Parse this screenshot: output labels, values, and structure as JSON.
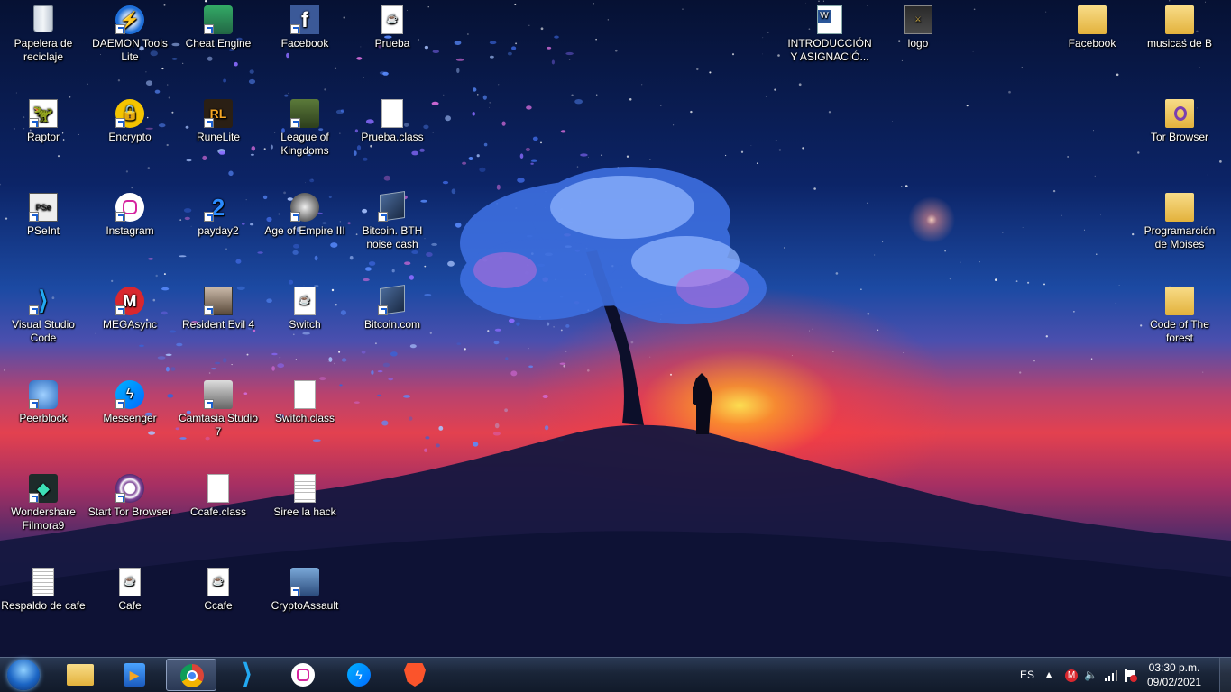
{
  "desktop": {
    "icons": [
      {
        "name": "recycle-bin",
        "label": "Papelera de reciclaje",
        "icon": "recycle-bin-icon",
        "shortcut": false
      },
      {
        "name": "daemon-tools-lite",
        "label": "DAEMON Tools Lite",
        "icon": "daemon-tools-icon",
        "shortcut": true
      },
      {
        "name": "cheat-engine",
        "label": "Cheat Engine",
        "icon": "cheat-engine-icon",
        "shortcut": true
      },
      {
        "name": "facebook",
        "label": "Facebook",
        "icon": "facebook-icon",
        "shortcut": true
      },
      {
        "name": "prueba",
        "label": "Prueba",
        "icon": "java-file-icon",
        "shortcut": false
      },
      {
        "name": "introduccion-doc",
        "label": "INTRODUCCIÓN Y ASIGNACIÓ...",
        "icon": "word-document-icon",
        "shortcut": false
      },
      {
        "name": "logo",
        "label": "logo",
        "icon": "image-file-icon",
        "shortcut": false
      },
      {
        "name": "facebook-folder",
        "label": "Facebook",
        "icon": "folder-icon",
        "shortcut": false
      },
      {
        "name": "musicas-de-b",
        "label": "musicas de B",
        "icon": "folder-icon",
        "shortcut": false
      },
      {
        "name": "raptor",
        "label": "Raptor",
        "icon": "raptor-icon",
        "shortcut": true
      },
      {
        "name": "encrypto",
        "label": "Encrypto",
        "icon": "encrypto-icon",
        "shortcut": true
      },
      {
        "name": "runelite",
        "label": "RuneLite",
        "icon": "runelite-icon",
        "shortcut": true
      },
      {
        "name": "league-of-kingdoms",
        "label": "League of Kingdoms",
        "icon": "league-of-kingdoms-icon",
        "shortcut": true
      },
      {
        "name": "prueba-class",
        "label": "Prueba.class",
        "icon": "blank-file-icon",
        "shortcut": false
      },
      {
        "name": "tor-browser-folder",
        "label": "Tor Browser",
        "icon": "tor-folder-icon",
        "shortcut": false
      },
      {
        "name": "pseint",
        "label": "PSeInt",
        "icon": "pseint-icon",
        "shortcut": true
      },
      {
        "name": "instagram",
        "label": "Instagram",
        "icon": "instagram-icon",
        "shortcut": true
      },
      {
        "name": "payday2",
        "label": "payday2",
        "icon": "payday2-icon",
        "shortcut": true
      },
      {
        "name": "age-of-empire-3",
        "label": "Age of Empire III",
        "icon": "age-of-empires-icon",
        "shortcut": true
      },
      {
        "name": "bitcoin-bth",
        "label": "Bitcoin. BTH noise cash",
        "icon": "cube-icon",
        "shortcut": true
      },
      {
        "name": "programarcion-moises",
        "label": "Programarción de Moises",
        "icon": "folder-icon",
        "shortcut": false
      },
      {
        "name": "visual-studio-code",
        "label": "Visual Studio Code",
        "icon": "vscode-icon",
        "shortcut": true
      },
      {
        "name": "megasync",
        "label": "MEGAsync",
        "icon": "mega-icon",
        "shortcut": true
      },
      {
        "name": "resident-evil-4",
        "label": "Resident Evil 4",
        "icon": "resident-evil-icon",
        "shortcut": true
      },
      {
        "name": "switch",
        "label": "Switch",
        "icon": "java-file-icon",
        "shortcut": false
      },
      {
        "name": "bitcoin-com",
        "label": "Bitcoin.com",
        "icon": "cube-icon",
        "shortcut": true
      },
      {
        "name": "code-of-the-forest",
        "label": "Code of The forest",
        "icon": "folder-icon",
        "shortcut": false
      },
      {
        "name": "peerblock",
        "label": "Peerblock",
        "icon": "peerblock-icon",
        "shortcut": true
      },
      {
        "name": "messenger",
        "label": "Messenger",
        "icon": "messenger-icon",
        "shortcut": true
      },
      {
        "name": "camtasia-studio-7",
        "label": "Camtasia Studio 7",
        "icon": "camtasia-icon",
        "shortcut": true
      },
      {
        "name": "switch-class",
        "label": "Switch.class",
        "icon": "blank-file-icon",
        "shortcut": false
      },
      {
        "name": "wondershare-filmora9",
        "label": "Wondershare Filmora9",
        "icon": "filmora-icon",
        "shortcut": true
      },
      {
        "name": "start-tor-browser",
        "label": "Start Tor Browser",
        "icon": "tor-icon",
        "shortcut": true
      },
      {
        "name": "ccafe-class",
        "label": "Ccafe.class",
        "icon": "blank-file-icon",
        "shortcut": false
      },
      {
        "name": "siree-la-hack",
        "label": "Siree la hack",
        "icon": "text-file-icon",
        "shortcut": false
      },
      {
        "name": "respaldo-de-cafe",
        "label": "Respaldo de cafe",
        "icon": "text-file-icon",
        "shortcut": false
      },
      {
        "name": "cafe",
        "label": "Cafe",
        "icon": "java-file-icon",
        "shortcut": false
      },
      {
        "name": "ccafe",
        "label": "Ccafe",
        "icon": "java-file-icon",
        "shortcut": false
      },
      {
        "name": "cryptoassault",
        "label": "CryptoAssault",
        "icon": "cryptoassault-icon",
        "shortcut": true
      }
    ]
  },
  "taskbar": {
    "start_button": "windows-start-icon",
    "pinned": [
      {
        "name": "file-explorer",
        "icon": "folder-icon",
        "active": false
      },
      {
        "name": "media-player",
        "icon": "media-player-icon",
        "active": false
      },
      {
        "name": "chrome",
        "icon": "chrome-icon",
        "active": true
      },
      {
        "name": "vscode",
        "icon": "vscode-icon",
        "active": false
      },
      {
        "name": "instagram",
        "icon": "instagram-icon",
        "active": false
      },
      {
        "name": "messenger",
        "icon": "messenger-icon",
        "active": false
      },
      {
        "name": "brave",
        "icon": "brave-icon",
        "active": false
      }
    ],
    "tray": {
      "language": "ES",
      "icons": [
        "show-hidden-icons-icon",
        "mega-icon",
        "volume-icon",
        "network-icon",
        "action-center-flag-icon"
      ],
      "time": "03:30 p.m.",
      "date": "09/02/2021"
    }
  },
  "colors": {
    "taskbar": "#1a2538",
    "chrome_active": "#3a4a66",
    "sun": "#ffd23a",
    "sky_top": "#061133"
  }
}
